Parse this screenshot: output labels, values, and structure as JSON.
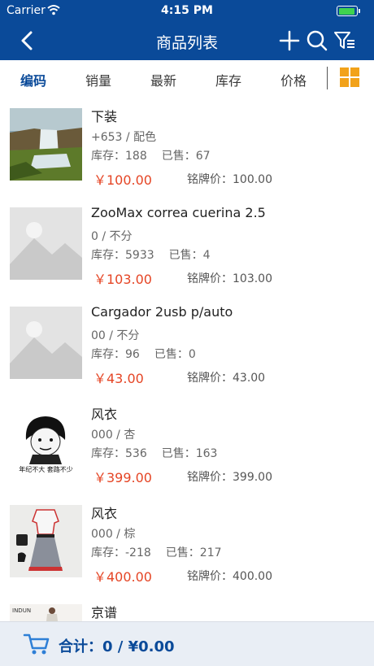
{
  "status_bar": {
    "carrier": "Carrier",
    "time": "4:15 PM"
  },
  "nav": {
    "title": "商品列表",
    "back_icon": "chevron-left-icon",
    "add_icon": "plus-icon",
    "search_icon": "search-icon",
    "filter_icon": "filter-list-icon"
  },
  "filters": [
    {
      "label": "编码",
      "active": true
    },
    {
      "label": "销量"
    },
    {
      "label": "最新"
    },
    {
      "label": "库存"
    },
    {
      "label": "价格"
    }
  ],
  "view_toggle_icon": "grid-view-icon",
  "colors": {
    "primary": "#0a4a99",
    "price": "#e54525",
    "accent": "#f2a21a"
  },
  "items": [
    {
      "name": "下装",
      "sub": "+653  /  配色",
      "stock": "库存：188",
      "sold": "已售：67",
      "price": "￥100.00",
      "brand_price": "铭牌价：100.00",
      "thumb": "waterfall-photo"
    },
    {
      "name": "ZooMax correa cuerina 2.5",
      "sub": "0  /  不分",
      "stock": "库存：5933",
      "sold": "已售：4",
      "price": "￥103.00",
      "brand_price": "铭牌价：103.00",
      "thumb": "placeholder-image"
    },
    {
      "name": "Cargador 2usb p/auto",
      "sub": "00  /  不分",
      "stock": "库存：96",
      "sold": "已售：0",
      "price": "￥43.00",
      "brand_price": "铭牌价：43.00",
      "thumb": "placeholder-image"
    },
    {
      "name": "风衣",
      "sub": "000  /  杏",
      "stock": "库存：536",
      "sold": "已售：163",
      "price": "￥399.00",
      "brand_price": "铭牌价：399.00",
      "thumb": "meme-face",
      "thumb_caption": "年纪不大 套路不少"
    },
    {
      "name": "风衣",
      "sub": "000  /  棕",
      "stock": "库存：-218",
      "sold": "已售：217",
      "price": "￥400.00",
      "brand_price": "铭牌价：400.00",
      "thumb": "dress-photo"
    },
    {
      "name": "京谱",
      "thumb": "fashion-photo",
      "thumb_caption": "INDUN"
    }
  ],
  "footer": {
    "cart_icon": "cart-icon",
    "total_label": "合计：",
    "total_value": "0  /  ¥0.00"
  }
}
